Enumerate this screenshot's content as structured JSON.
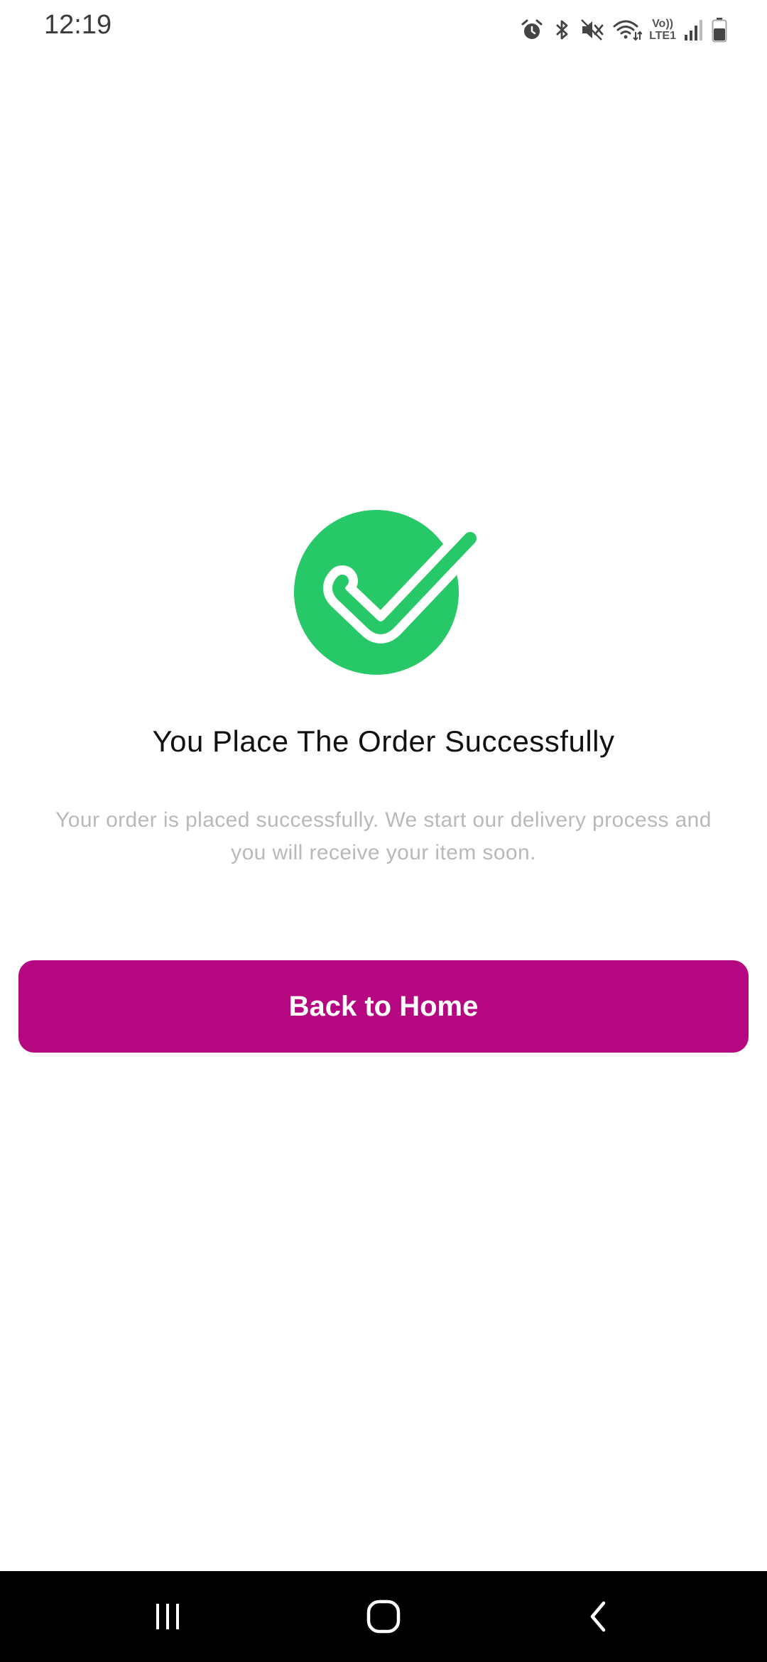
{
  "status_bar": {
    "time": "12:19",
    "icons": [
      "alarm-icon",
      "bluetooth-icon",
      "mute-icon",
      "wifi-icon",
      "volte-icon",
      "signal-icon",
      "battery-icon"
    ],
    "volte_top": "Vo))",
    "volte_bottom": "LTE1"
  },
  "main": {
    "icon": "check-circle-icon",
    "title": "You Place The Order Successfully",
    "message": "Your order is placed successfully. We start our delivery process and you will receive your item soon.",
    "button_label": "Back to Home"
  },
  "nav_bar": {
    "icons": [
      "recent-apps-icon",
      "home-icon",
      "back-icon"
    ]
  },
  "colors": {
    "accent": "#b5077f",
    "success": "#27c867",
    "title_text": "#111111",
    "muted_text": "#b9b9bd",
    "nav_background": "#000000"
  }
}
